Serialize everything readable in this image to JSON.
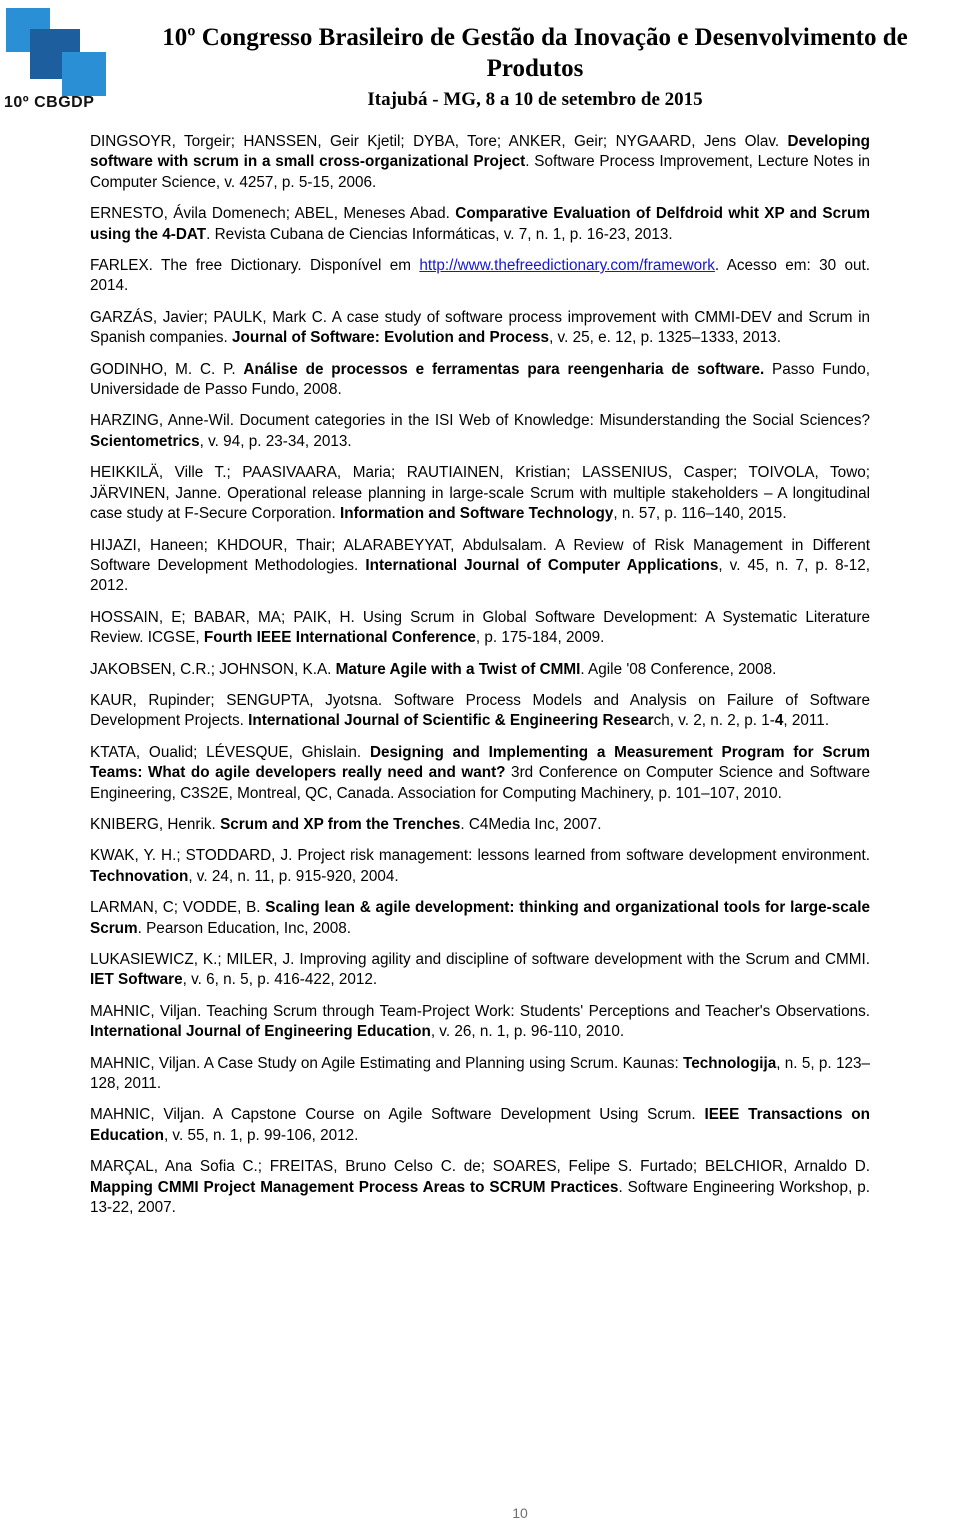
{
  "header": {
    "logo_text": "10º CBGDP",
    "title_line1": "10º Congresso Brasileiro de Gestão da Inovação e Desenvolvimento de Produtos",
    "title_line2": "Itajubá - MG, 8 a 10 de setembro de 2015"
  },
  "references": [
    {
      "id": "dingsoyr",
      "parts": [
        {
          "text": "DINGSOYR, Torgeir; HANSSEN, Geir Kjetil; DYBA, Tore; ANKER, Geir; NYGAARD, Jens Olav. ",
          "bold": false
        },
        {
          "text": "Developing software with scrum in a small cross-organizational Project",
          "bold": true
        },
        {
          "text": ". Software Process Improvement, Lecture Notes in Computer Science,  v. 4257, p. 5-15, 2006.",
          "bold": false
        }
      ]
    },
    {
      "id": "ernesto",
      "parts": [
        {
          "text": "ERNESTO, Ávila Domenech; ABEL, Meneses Abad. ",
          "bold": false
        },
        {
          "text": "Comparative Evaluation of Delfdroid whit XP and Scrum using the 4-DAT",
          "bold": true
        },
        {
          "text": ". Revista Cubana de Ciencias Informáticas, v. 7, n. 1, p. 16-23, 2013.",
          "bold": false
        }
      ]
    },
    {
      "id": "farlex",
      "parts": [
        {
          "text": "FARLEX. The free Dictionary. Disponível em ",
          "bold": false
        },
        {
          "text": "http://www.thefreedictionary.com/framework",
          "bold": false,
          "link": true
        },
        {
          "text": ". Acesso em: 30 out. 2014.",
          "bold": false
        }
      ]
    },
    {
      "id": "garzas",
      "parts": [
        {
          "text": "GARZÁS, Javier; PAULK, Mark C. A case study of software process improvement with CMMI-DEV and Scrum in Spanish companies. ",
          "bold": false
        },
        {
          "text": "Journal of Software: Evolution and Process",
          "bold": true
        },
        {
          "text": ", v. 25, e. 12, p. 1325–1333, 2013.",
          "bold": false
        }
      ]
    },
    {
      "id": "godinho",
      "parts": [
        {
          "text": "GODINHO, M. C. P. ",
          "bold": false
        },
        {
          "text": "Análise de processos e ferramentas para reengenharia de software.",
          "bold": true
        },
        {
          "text": "  Passo Fundo, Universidade de Passo Fundo, 2008.",
          "bold": false
        }
      ]
    },
    {
      "id": "harzing",
      "parts": [
        {
          "text": "HARZING, Anne-Wil. Document categories in the ISI Web of Knowledge: Misunderstanding the Social Sciences? ",
          "bold": false
        },
        {
          "text": "Scientometrics",
          "bold": true
        },
        {
          "text": ", v. 94, p. 23-34, 2013.",
          "bold": false
        }
      ]
    },
    {
      "id": "heikkila",
      "parts": [
        {
          "text": "HEIKKILÄ, Ville T.; PAASIVAARA, Maria; RAUTIAINEN, Kristian; LASSENIUS, Casper; TOIVOLA, Towo; JÄRVINEN, Janne. Operational release planning in large-scale Scrum with multiple stakeholders – A longitudinal case study at F-Secure Corporation. ",
          "bold": false
        },
        {
          "text": "Information and Software Technology",
          "bold": true
        },
        {
          "text": ", n. 57, p. 116–140, 2015.",
          "bold": false
        }
      ]
    },
    {
      "id": "hijazi",
      "parts": [
        {
          "text": "HIJAZI, Haneen; KHDOUR, Thair; ALARABEYYAT, Abdulsalam. A Review of Risk Management in Different Software Development Methodologies. ",
          "bold": false
        },
        {
          "text": "International Journal of Computer Applications",
          "bold": true
        },
        {
          "text": ", v. 45, n. 7, p. 8-12, 2012.",
          "bold": false
        }
      ]
    },
    {
      "id": "hossain",
      "parts": [
        {
          "text": "HOSSAIN, E; BABAR, MA; PAIK, H. Using Scrum in Global Software Development: A Systematic Literature Review. ICGSE, ",
          "bold": false
        },
        {
          "text": "Fourth IEEE International Conference",
          "bold": true
        },
        {
          "text": ", p. 175-184, 2009.",
          "bold": false
        }
      ]
    },
    {
      "id": "jakobsen",
      "parts": [
        {
          "text": "JAKOBSEN, C.R.; JOHNSON, K.A. ",
          "bold": false
        },
        {
          "text": "Mature Agile with a Twist of CMMI",
          "bold": true
        },
        {
          "text": ". Agile '08 Conference, 2008.",
          "bold": false
        }
      ]
    },
    {
      "id": "kaur",
      "parts": [
        {
          "text": "KAUR, Rupinder; SENGUPTA, Jyotsna. Software Process Models and Analysis on Failure of Software Development Projects. ",
          "bold": false
        },
        {
          "text": "International Journal of Scientific & Engineering Resear",
          "bold": true
        },
        {
          "text": "ch, v. 2, n. 2, p. 1-",
          "bold": false
        },
        {
          "text": "4",
          "bold": true
        },
        {
          "text": ", 2011.",
          "bold": false
        }
      ]
    },
    {
      "id": "ktata",
      "parts": [
        {
          "text": "KTATA, Oualid; LÉVESQUE, Ghislain. ",
          "bold": false
        },
        {
          "text": "Designing and Implementing a Measurement Program for Scrum Teams: What do agile developers really need and want?",
          "bold": true
        },
        {
          "text": " 3rd Conference on Computer Science and Software Engineering, C3S2E, Montreal, QC, Canada. Association for Computing Machinery, p. 101–107, 2010.",
          "bold": false
        }
      ]
    },
    {
      "id": "kniberg",
      "parts": [
        {
          "text": "KNIBERG, Henrik. ",
          "bold": false
        },
        {
          "text": "Scrum and XP from the Trenches",
          "bold": true
        },
        {
          "text": ". C4Media Inc, 2007.",
          "bold": false
        }
      ]
    },
    {
      "id": "kwak",
      "parts": [
        {
          "text": "KWAK, Y. H.; STODDARD, J. Project risk management: lessons learned from software development environment. ",
          "bold": false
        },
        {
          "text": "Technovation",
          "bold": true
        },
        {
          "text": ", v. 24, n. 11, p. 915-920, 2004.",
          "bold": false
        }
      ]
    },
    {
      "id": "larman",
      "parts": [
        {
          "text": "LARMAN, C; VODDE, B. ",
          "bold": false
        },
        {
          "text": "Scaling lean & agile development: thinking and organizational tools for large-scale Scrum",
          "bold": true
        },
        {
          "text": ". Pearson Education, Inc, 2008.",
          "bold": false
        }
      ]
    },
    {
      "id": "lukasiewicz",
      "parts": [
        {
          "text": "LUKASIEWICZ, K.; MILER, J. Improving agility and discipline of software development with the Scrum and CMMI. ",
          "bold": false
        },
        {
          "text": "IET Software",
          "bold": true
        },
        {
          "text": ", v. 6, n. 5, p. 416-422, 2012.",
          "bold": false
        }
      ]
    },
    {
      "id": "mahnic-teaching",
      "parts": [
        {
          "text": "MAHNIC, Viljan. Teaching Scrum through Team-Project Work: Students' Perceptions and Teacher's Observations. ",
          "bold": false
        },
        {
          "text": "International Journal of Engineering Education",
          "bold": true
        },
        {
          "text": ", v. 26, n. 1, p. 96-110, 2010.",
          "bold": false
        }
      ]
    },
    {
      "id": "mahnic-casestudy",
      "parts": [
        {
          "text": "MAHNIC, Viljan. A Case Study on Agile Estimating and Planning using Scrum. Kaunas: ",
          "bold": false
        },
        {
          "text": "Technologija",
          "bold": true
        },
        {
          "text": ", n. 5, p. 123–128, 2011.",
          "bold": false
        }
      ]
    },
    {
      "id": "mahnic-capstone",
      "parts": [
        {
          "text": "MAHNIC, Viljan. A Capstone Course on Agile Software Development Using Scrum. ",
          "bold": false
        },
        {
          "text": "IEEE Transactions on Education",
          "bold": true
        },
        {
          "text": ", v. 55, n. 1, p. 99-106, 2012.",
          "bold": false
        }
      ]
    },
    {
      "id": "marcal",
      "parts": [
        {
          "text": "MARÇAL, Ana Sofia C.; FREITAS, Bruno Celso C. de; SOARES, Felipe S. Furtado; BELCHIOR, Arnaldo D. ",
          "bold": false
        },
        {
          "text": "Mapping CMMI Project Management Process Areas to SCRUM Practices",
          "bold": true
        },
        {
          "text": ". Software Engineering Workshop, p. 13-22, 2007.",
          "bold": false
        }
      ]
    }
  ],
  "footer": {
    "page_number": "10"
  }
}
